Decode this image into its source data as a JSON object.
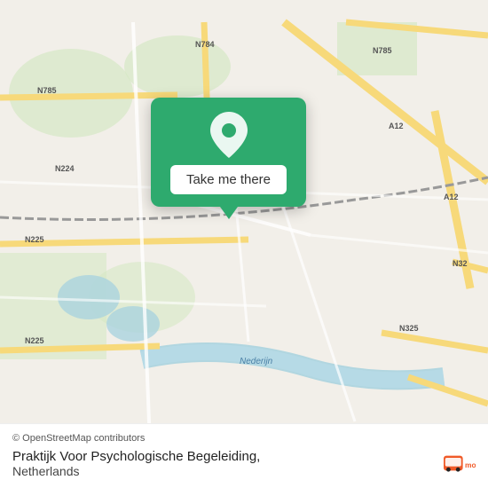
{
  "map": {
    "background_color": "#f2efe9"
  },
  "popup": {
    "button_label": "Take me there",
    "background_color": "#2eaa6e"
  },
  "bottom_bar": {
    "credit": "© OpenStreetMap contributors",
    "place_name": "Praktijk Voor Psychologische Begeleiding,",
    "place_country": "Netherlands"
  },
  "moovit": {
    "logo_text": "moovit"
  }
}
